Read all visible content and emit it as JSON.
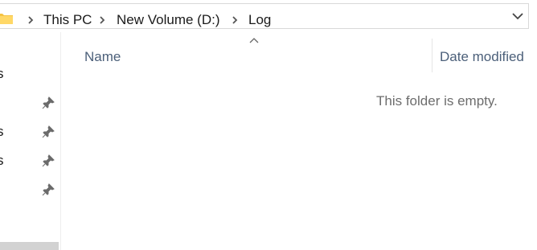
{
  "window": {
    "title": "Log"
  },
  "addressbar": {
    "breadcrumbs": [
      "This PC",
      "New Volume (D:)",
      "Log"
    ],
    "folder_icon": "folder-icon",
    "separator_icon": "chevron-right-icon",
    "history_icon": "chevron-down-icon"
  },
  "navpane": {
    "items": [
      {
        "label": "s",
        "pinned": false
      },
      {
        "label": "",
        "pinned": true
      },
      {
        "label": "s",
        "pinned": true
      },
      {
        "label": "s",
        "pinned": true
      },
      {
        "label": "",
        "pinned": true
      }
    ],
    "pin_icon": "pin-icon"
  },
  "content": {
    "columns": [
      "Name",
      "Date modified"
    ],
    "sort_icon": "sort-ascending-icon",
    "empty_message": "This folder is empty."
  },
  "colors": {
    "column_header": "#4c607a",
    "empty_text": "#6d6d6d",
    "folder": "#f5c342"
  }
}
